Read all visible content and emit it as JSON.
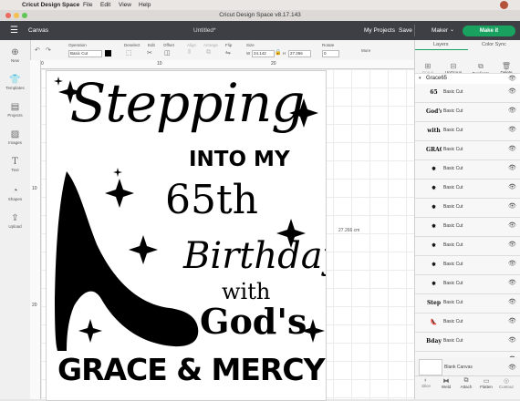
{
  "macbar": {
    "app_name": "Cricut Design Space",
    "menus": [
      "File",
      "Edit",
      "View",
      "Help"
    ]
  },
  "window": {
    "title": "Cricut Design Space  v8.17.143"
  },
  "header": {
    "section": "Canvas",
    "doc_title": "Untitled*",
    "my_projects": "My Projects",
    "save": "Save",
    "machine": "Maker",
    "make_it": "Make it"
  },
  "toolbar": {
    "operation_label": "Operation",
    "operation_value": "Basic Cut",
    "deselect": "Deselect",
    "edit": "Edit",
    "offset": "Offset",
    "align": "Align",
    "arrange": "Arrange",
    "flip": "Flip",
    "size_label": "Size",
    "w_label": "W",
    "w_value": "24.142",
    "h_label": "H",
    "h_value": "27.266",
    "rotate_label": "Rotate",
    "rotate_value": "0",
    "more": "More"
  },
  "sidebar": [
    {
      "label": "New",
      "icon": "plus-icon"
    },
    {
      "label": "Templates",
      "icon": "shirt-icon"
    },
    {
      "label": "Projects",
      "icon": "projects-icon"
    },
    {
      "label": "Images",
      "icon": "images-icon"
    },
    {
      "label": "Text",
      "icon": "text-icon"
    },
    {
      "label": "Shapes",
      "icon": "shapes-icon"
    },
    {
      "label": "Upload",
      "icon": "upload-icon"
    }
  ],
  "rulers": {
    "h_ticks": [
      "0",
      "10",
      "20"
    ],
    "v_ticks": [
      "10",
      "20"
    ]
  },
  "canvas": {
    "height_readout": "27.266 cm"
  },
  "design": {
    "line1": "Stepping",
    "line2": "INTO MY",
    "line3": "65th",
    "line4": "Birthday",
    "line5": "with",
    "line6": "God's",
    "line7": "GRACE & MERCY"
  },
  "panel": {
    "tab_layers": "Layers",
    "tab_color_sync": "Color Sync",
    "actions": [
      "Group",
      "UnGroup",
      "Duplicate",
      "Delete"
    ],
    "group_name": "Grace65",
    "layers": [
      {
        "thumb": "65",
        "name": "Basic Cut"
      },
      {
        "thumb": "God's",
        "name": "Basic Cut"
      },
      {
        "thumb": "with",
        "name": "Basic Cut"
      },
      {
        "thumb": "GRACE",
        "name": "Basic Cut"
      },
      {
        "thumb": "✸",
        "name": "Basic Cut"
      },
      {
        "thumb": "✸",
        "name": "Basic Cut"
      },
      {
        "thumb": "✸",
        "name": "Basic Cut"
      },
      {
        "thumb": "✸",
        "name": "Basic Cut"
      },
      {
        "thumb": "✸",
        "name": "Basic Cut"
      },
      {
        "thumb": "✸",
        "name": "Basic Cut"
      },
      {
        "thumb": "✸",
        "name": "Basic Cut"
      },
      {
        "thumb": "Step",
        "name": "Basic Cut"
      },
      {
        "thumb": "👠",
        "name": "Basic Cut"
      },
      {
        "thumb": "Bday",
        "name": "Basic Cut"
      },
      {
        "thumb": "MY",
        "name": "Basic Cut"
      },
      {
        "thumb": "INTO",
        "name": "Basic Cut"
      }
    ],
    "blank_canvas": "Blank Canvas",
    "bottom_actions": [
      "Slice",
      "Weld",
      "Attach",
      "Flatten",
      "Contour"
    ]
  }
}
